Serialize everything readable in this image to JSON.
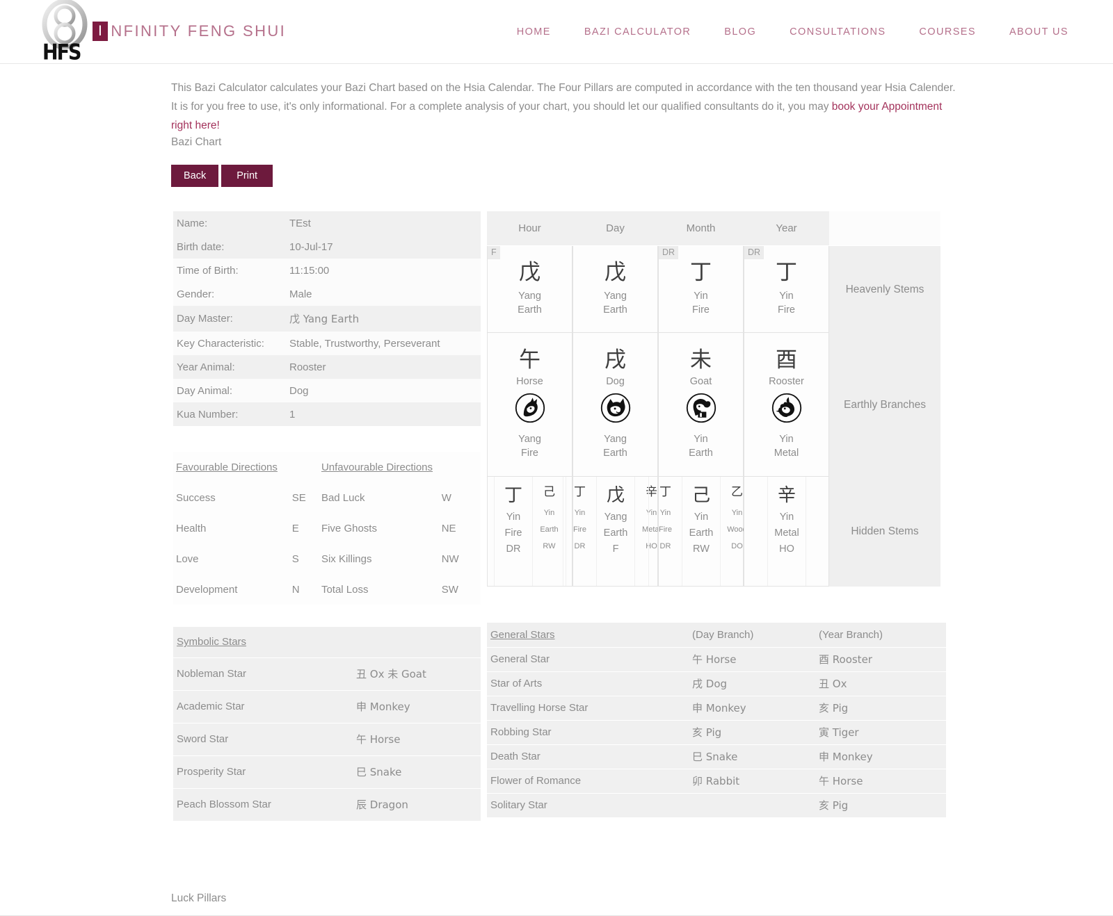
{
  "brand": {
    "initial": "I",
    "rest": "NFINITY FENG SHUI",
    "logo_text": "HFS",
    "accent": "#7d1b41",
    "nav_color": "#b5708b"
  },
  "nav": {
    "items": [
      {
        "label": "HOME"
      },
      {
        "label": "BAZI CALCULATOR"
      },
      {
        "label": "BLOG"
      },
      {
        "label": "CONSULTATIONS"
      },
      {
        "label": "COURSES"
      },
      {
        "label": "ABOUT US"
      }
    ]
  },
  "intro": {
    "text_before": "This Bazi Calculator calculates your Bazi Chart based on the Hsia Calendar. The Four Pillars are computed in accordance with the ten thousand year Hsia Calender. It is for you free to use, it's only informational. For a complete analysis of your chart, you should let our qualified consultants do it, you may ",
    "link_text": "book your Appointment right here!",
    "link_color": "#a3325b"
  },
  "section_title": "Bazi Chart",
  "buttons": {
    "back": "Back",
    "print": "Print"
  },
  "info": {
    "rows": [
      {
        "key": "Name:",
        "value": "TEst"
      },
      {
        "key": "Birth date:",
        "value": "10-Jul-17"
      },
      {
        "key": "Time of Birth:",
        "value": "11:15:00"
      },
      {
        "key": "Gender:",
        "value": "Male"
      },
      {
        "key": "Day Master:",
        "value": "戊 Yang Earth"
      },
      {
        "key": "Key Characteristic:",
        "value": "Stable, Trustworthy, Perseverant"
      },
      {
        "key": "Year Animal:",
        "value": "Rooster"
      },
      {
        "key": "Day Animal:",
        "value": "Dog"
      },
      {
        "key": "Kua Number:",
        "value": "1"
      }
    ]
  },
  "directions": {
    "favourable_header": "Favourable Directions",
    "unfavourable_header": "Unfavourable Directions",
    "rows": [
      {
        "fav": "Success",
        "fav_dir": "SE",
        "unfav": "Bad Luck",
        "unfav_dir": "W"
      },
      {
        "fav": "Health",
        "fav_dir": "E",
        "unfav": "Five Ghosts",
        "unfav_dir": "NE"
      },
      {
        "fav": "Love",
        "fav_dir": "S",
        "unfav": "Six Killings",
        "unfav_dir": "NW"
      },
      {
        "fav": "Development",
        "fav_dir": "N",
        "unfav": "Total Loss",
        "unfav_dir": "SW"
      }
    ]
  },
  "pillars": {
    "row_labels": {
      "heavenly": "Heavenly Stems",
      "earthly": "Earthly Branches",
      "hidden": "Hidden Stems"
    },
    "columns": [
      {
        "header": "Hour",
        "stem": {
          "tag": "F",
          "char": "戊",
          "polarity": "Yang",
          "element": "Earth"
        },
        "branch": {
          "char": "午",
          "animal": "Horse",
          "icon": "horse-icon",
          "polarity": "Yang",
          "element": "Fire"
        },
        "hidden": [
          {
            "size": "main",
            "char": "丁",
            "polarity": "Yin",
            "element": "Fire",
            "god": "DR"
          },
          {
            "size": "sub",
            "char": "己",
            "polarity": "Yin",
            "element": "Earth",
            "god": "RW"
          }
        ]
      },
      {
        "header": "Day",
        "stem": {
          "tag": "",
          "char": "戊",
          "polarity": "Yang",
          "element": "Earth"
        },
        "branch": {
          "char": "戌",
          "animal": "Dog",
          "icon": "dog-icon",
          "polarity": "Yang",
          "element": "Earth"
        },
        "hidden": [
          {
            "size": "sub",
            "char": "丁",
            "polarity": "Yin",
            "element": "Fire",
            "god": "DR"
          },
          {
            "size": "main",
            "char": "戊",
            "polarity": "Yang",
            "element": "Earth",
            "god": "F"
          },
          {
            "size": "sub",
            "char": "辛",
            "polarity": "Yin",
            "element": "Metal",
            "god": "HO"
          }
        ]
      },
      {
        "header": "Month",
        "stem": {
          "tag": "DR",
          "char": "丁",
          "polarity": "Yin",
          "element": "Fire"
        },
        "branch": {
          "char": "未",
          "animal": "Goat",
          "icon": "goat-icon",
          "polarity": "Yin",
          "element": "Earth"
        },
        "hidden": [
          {
            "size": "sub",
            "char": "丁",
            "polarity": "Yin",
            "element": "Fire",
            "god": "DR"
          },
          {
            "size": "main",
            "char": "己",
            "polarity": "Yin",
            "element": "Earth",
            "god": "RW"
          },
          {
            "size": "sub",
            "char": "乙",
            "polarity": "Yin",
            "element": "Wood",
            "god": "DO"
          }
        ]
      },
      {
        "header": "Year",
        "stem": {
          "tag": "DR",
          "char": "丁",
          "polarity": "Yin",
          "element": "Fire"
        },
        "branch": {
          "char": "酉",
          "animal": "Rooster",
          "icon": "rooster-icon",
          "polarity": "Yin",
          "element": "Metal"
        },
        "hidden": [
          {
            "size": "main",
            "char": "辛",
            "polarity": "Yin",
            "element": "Metal",
            "god": "HO"
          }
        ]
      }
    ]
  },
  "symbolic_stars": {
    "header": "Symbolic Stars",
    "header_value": "",
    "rows": [
      {
        "name": "Nobleman Star",
        "value": "丑 Ox 未 Goat"
      },
      {
        "name": "Academic Star",
        "value": "申 Monkey"
      },
      {
        "name": "Sword Star",
        "value": "午 Horse"
      },
      {
        "name": "Prosperity Star",
        "value": "巳 Snake"
      },
      {
        "name": "Peach Blossom Star",
        "value": "辰 Dragon"
      }
    ]
  },
  "general_stars": {
    "header": "General Stars",
    "col_day": "(Day Branch)",
    "col_year": "(Year Branch)",
    "rows": [
      {
        "name": "General Star",
        "day": "午 Horse",
        "year": "酉 Rooster"
      },
      {
        "name": "Star of Arts",
        "day": "戌 Dog",
        "year": "丑 Ox"
      },
      {
        "name": "Travelling Horse Star",
        "day": "申 Monkey",
        "year": "亥 Pig"
      },
      {
        "name": "Robbing Star",
        "day": "亥 Pig",
        "year": "寅 Tiger"
      },
      {
        "name": "Death Star",
        "day": "巳 Snake",
        "year": "申 Monkey"
      },
      {
        "name": "Flower of Romance",
        "day": "卯 Rabbit",
        "year": "午 Horse"
      },
      {
        "name": "Solitary Star",
        "day": "",
        "year": "亥 Pig"
      }
    ]
  },
  "luck_pillars_label": "Luck Pillars"
}
